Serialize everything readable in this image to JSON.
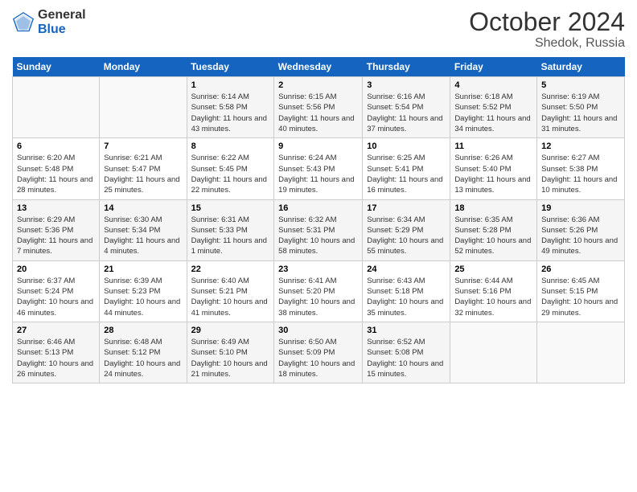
{
  "header": {
    "logo_general": "General",
    "logo_blue": "Blue",
    "month": "October 2024",
    "location": "Shedok, Russia"
  },
  "days_of_week": [
    "Sunday",
    "Monday",
    "Tuesday",
    "Wednesday",
    "Thursday",
    "Friday",
    "Saturday"
  ],
  "weeks": [
    [
      {
        "num": "",
        "info": ""
      },
      {
        "num": "",
        "info": ""
      },
      {
        "num": "1",
        "info": "Sunrise: 6:14 AM\nSunset: 5:58 PM\nDaylight: 11 hours and 43 minutes."
      },
      {
        "num": "2",
        "info": "Sunrise: 6:15 AM\nSunset: 5:56 PM\nDaylight: 11 hours and 40 minutes."
      },
      {
        "num": "3",
        "info": "Sunrise: 6:16 AM\nSunset: 5:54 PM\nDaylight: 11 hours and 37 minutes."
      },
      {
        "num": "4",
        "info": "Sunrise: 6:18 AM\nSunset: 5:52 PM\nDaylight: 11 hours and 34 minutes."
      },
      {
        "num": "5",
        "info": "Sunrise: 6:19 AM\nSunset: 5:50 PM\nDaylight: 11 hours and 31 minutes."
      }
    ],
    [
      {
        "num": "6",
        "info": "Sunrise: 6:20 AM\nSunset: 5:48 PM\nDaylight: 11 hours and 28 minutes."
      },
      {
        "num": "7",
        "info": "Sunrise: 6:21 AM\nSunset: 5:47 PM\nDaylight: 11 hours and 25 minutes."
      },
      {
        "num": "8",
        "info": "Sunrise: 6:22 AM\nSunset: 5:45 PM\nDaylight: 11 hours and 22 minutes."
      },
      {
        "num": "9",
        "info": "Sunrise: 6:24 AM\nSunset: 5:43 PM\nDaylight: 11 hours and 19 minutes."
      },
      {
        "num": "10",
        "info": "Sunrise: 6:25 AM\nSunset: 5:41 PM\nDaylight: 11 hours and 16 minutes."
      },
      {
        "num": "11",
        "info": "Sunrise: 6:26 AM\nSunset: 5:40 PM\nDaylight: 11 hours and 13 minutes."
      },
      {
        "num": "12",
        "info": "Sunrise: 6:27 AM\nSunset: 5:38 PM\nDaylight: 11 hours and 10 minutes."
      }
    ],
    [
      {
        "num": "13",
        "info": "Sunrise: 6:29 AM\nSunset: 5:36 PM\nDaylight: 11 hours and 7 minutes."
      },
      {
        "num": "14",
        "info": "Sunrise: 6:30 AM\nSunset: 5:34 PM\nDaylight: 11 hours and 4 minutes."
      },
      {
        "num": "15",
        "info": "Sunrise: 6:31 AM\nSunset: 5:33 PM\nDaylight: 11 hours and 1 minute."
      },
      {
        "num": "16",
        "info": "Sunrise: 6:32 AM\nSunset: 5:31 PM\nDaylight: 10 hours and 58 minutes."
      },
      {
        "num": "17",
        "info": "Sunrise: 6:34 AM\nSunset: 5:29 PM\nDaylight: 10 hours and 55 minutes."
      },
      {
        "num": "18",
        "info": "Sunrise: 6:35 AM\nSunset: 5:28 PM\nDaylight: 10 hours and 52 minutes."
      },
      {
        "num": "19",
        "info": "Sunrise: 6:36 AM\nSunset: 5:26 PM\nDaylight: 10 hours and 49 minutes."
      }
    ],
    [
      {
        "num": "20",
        "info": "Sunrise: 6:37 AM\nSunset: 5:24 PM\nDaylight: 10 hours and 46 minutes."
      },
      {
        "num": "21",
        "info": "Sunrise: 6:39 AM\nSunset: 5:23 PM\nDaylight: 10 hours and 44 minutes."
      },
      {
        "num": "22",
        "info": "Sunrise: 6:40 AM\nSunset: 5:21 PM\nDaylight: 10 hours and 41 minutes."
      },
      {
        "num": "23",
        "info": "Sunrise: 6:41 AM\nSunset: 5:20 PM\nDaylight: 10 hours and 38 minutes."
      },
      {
        "num": "24",
        "info": "Sunrise: 6:43 AM\nSunset: 5:18 PM\nDaylight: 10 hours and 35 minutes."
      },
      {
        "num": "25",
        "info": "Sunrise: 6:44 AM\nSunset: 5:16 PM\nDaylight: 10 hours and 32 minutes."
      },
      {
        "num": "26",
        "info": "Sunrise: 6:45 AM\nSunset: 5:15 PM\nDaylight: 10 hours and 29 minutes."
      }
    ],
    [
      {
        "num": "27",
        "info": "Sunrise: 6:46 AM\nSunset: 5:13 PM\nDaylight: 10 hours and 26 minutes."
      },
      {
        "num": "28",
        "info": "Sunrise: 6:48 AM\nSunset: 5:12 PM\nDaylight: 10 hours and 24 minutes."
      },
      {
        "num": "29",
        "info": "Sunrise: 6:49 AM\nSunset: 5:10 PM\nDaylight: 10 hours and 21 minutes."
      },
      {
        "num": "30",
        "info": "Sunrise: 6:50 AM\nSunset: 5:09 PM\nDaylight: 10 hours and 18 minutes."
      },
      {
        "num": "31",
        "info": "Sunrise: 6:52 AM\nSunset: 5:08 PM\nDaylight: 10 hours and 15 minutes."
      },
      {
        "num": "",
        "info": ""
      },
      {
        "num": "",
        "info": ""
      }
    ]
  ]
}
